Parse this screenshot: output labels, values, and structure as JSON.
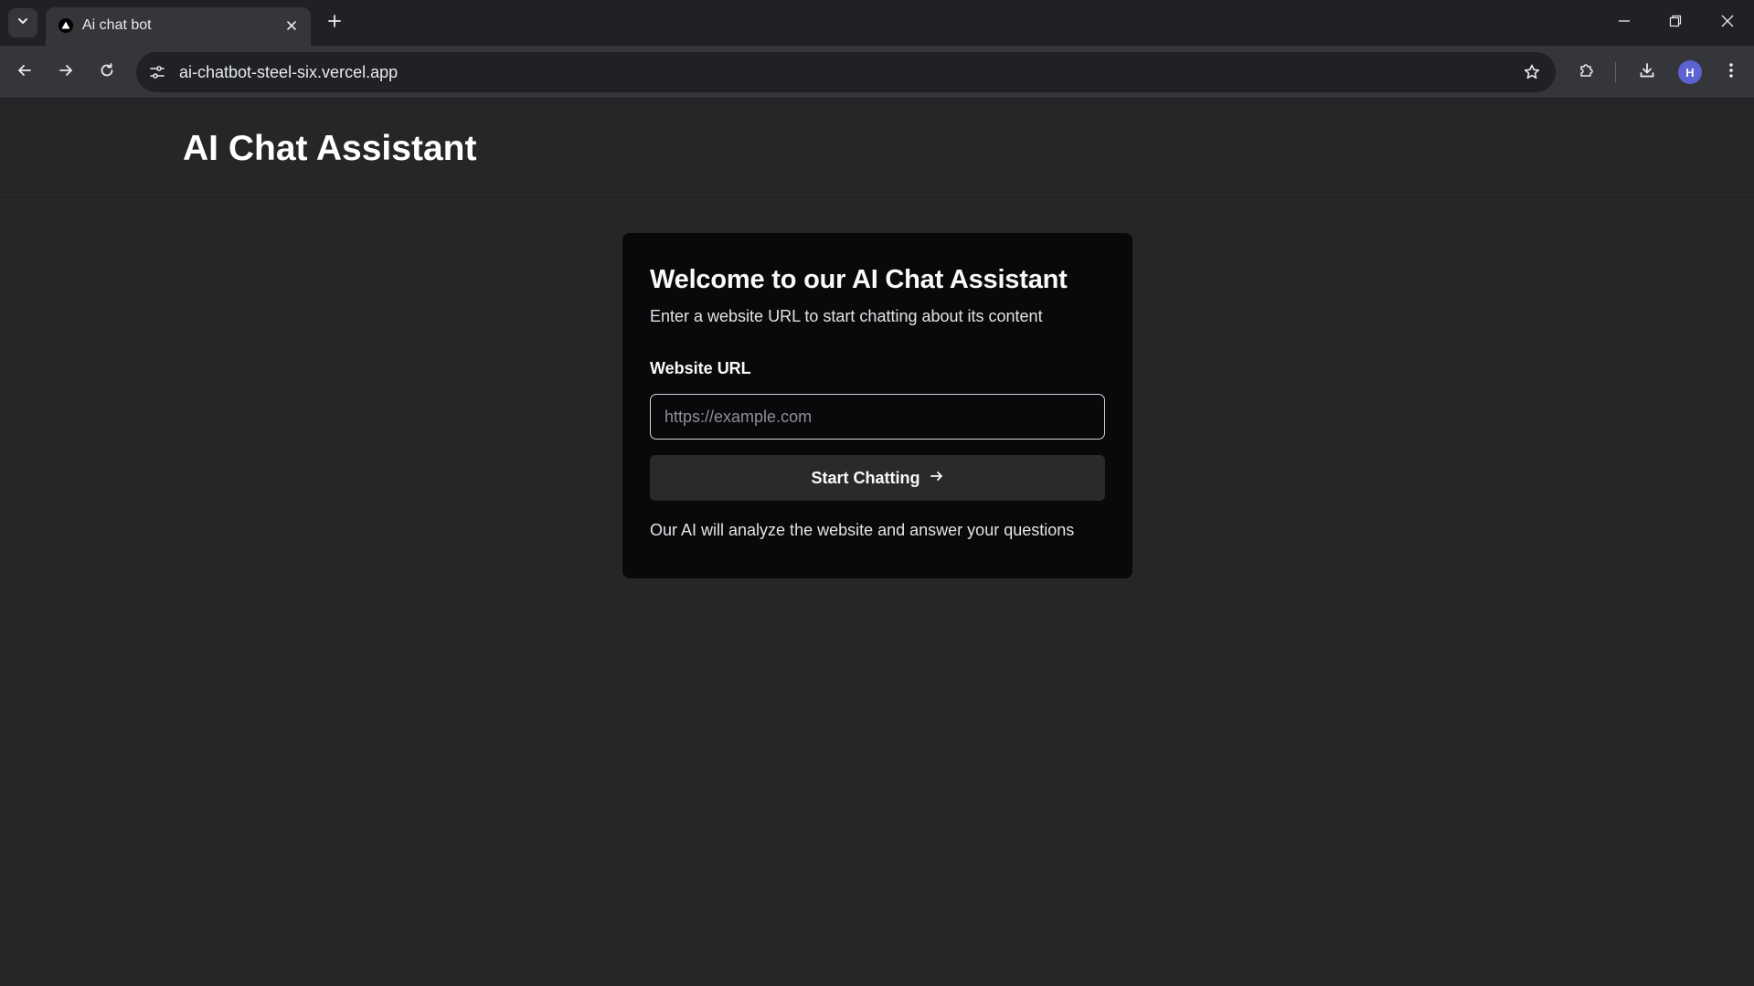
{
  "browser": {
    "tab_title": "Ai chat bot",
    "url": "ai-chatbot-steel-six.vercel.app",
    "profile_initial": "H"
  },
  "page": {
    "site_title": "AI Chat Assistant",
    "card": {
      "title": "Welcome to our AI Chat Assistant",
      "description": "Enter a website URL to start chatting about its content",
      "field_label": "Website URL",
      "input_placeholder": "https://example.com",
      "input_value": "",
      "button_label": "Start Chatting",
      "note": "Our AI will analyze the website and answer your questions"
    }
  },
  "colors": {
    "page_background": "#262628",
    "card_background": "#09090b",
    "button_background": "#2a2a2d",
    "avatar": "#5b63d3"
  }
}
